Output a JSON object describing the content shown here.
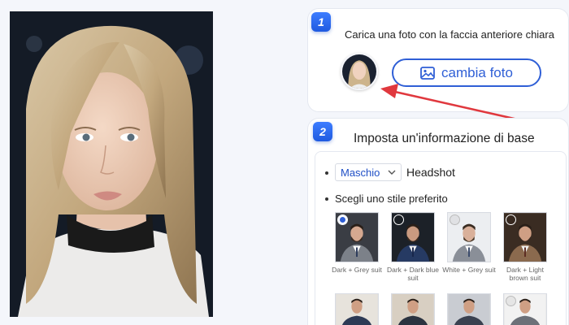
{
  "step1": {
    "number": "1",
    "title": "Carica una foto con la faccia anteriore chiara",
    "button_label": "cambia foto",
    "button_icon": "image-icon"
  },
  "step2": {
    "number": "2",
    "title": "Imposta un'informazione di base",
    "gender_select": {
      "selected": "Maschio"
    },
    "headshot_label": "Headshot",
    "style_label": "Scegli uno stile preferito",
    "styles": [
      {
        "caption": "Dark + Grey suit",
        "selected": true
      },
      {
        "caption": "Dark + Dark blue suit",
        "selected": false
      },
      {
        "caption": "White + Grey suit",
        "selected": false
      },
      {
        "caption": "Dark + Light brown suit",
        "selected": false
      }
    ]
  },
  "colors": {
    "accent": "#2f5fd6",
    "arrow": "#e0383e",
    "page_bg": "#f4f6fb"
  }
}
